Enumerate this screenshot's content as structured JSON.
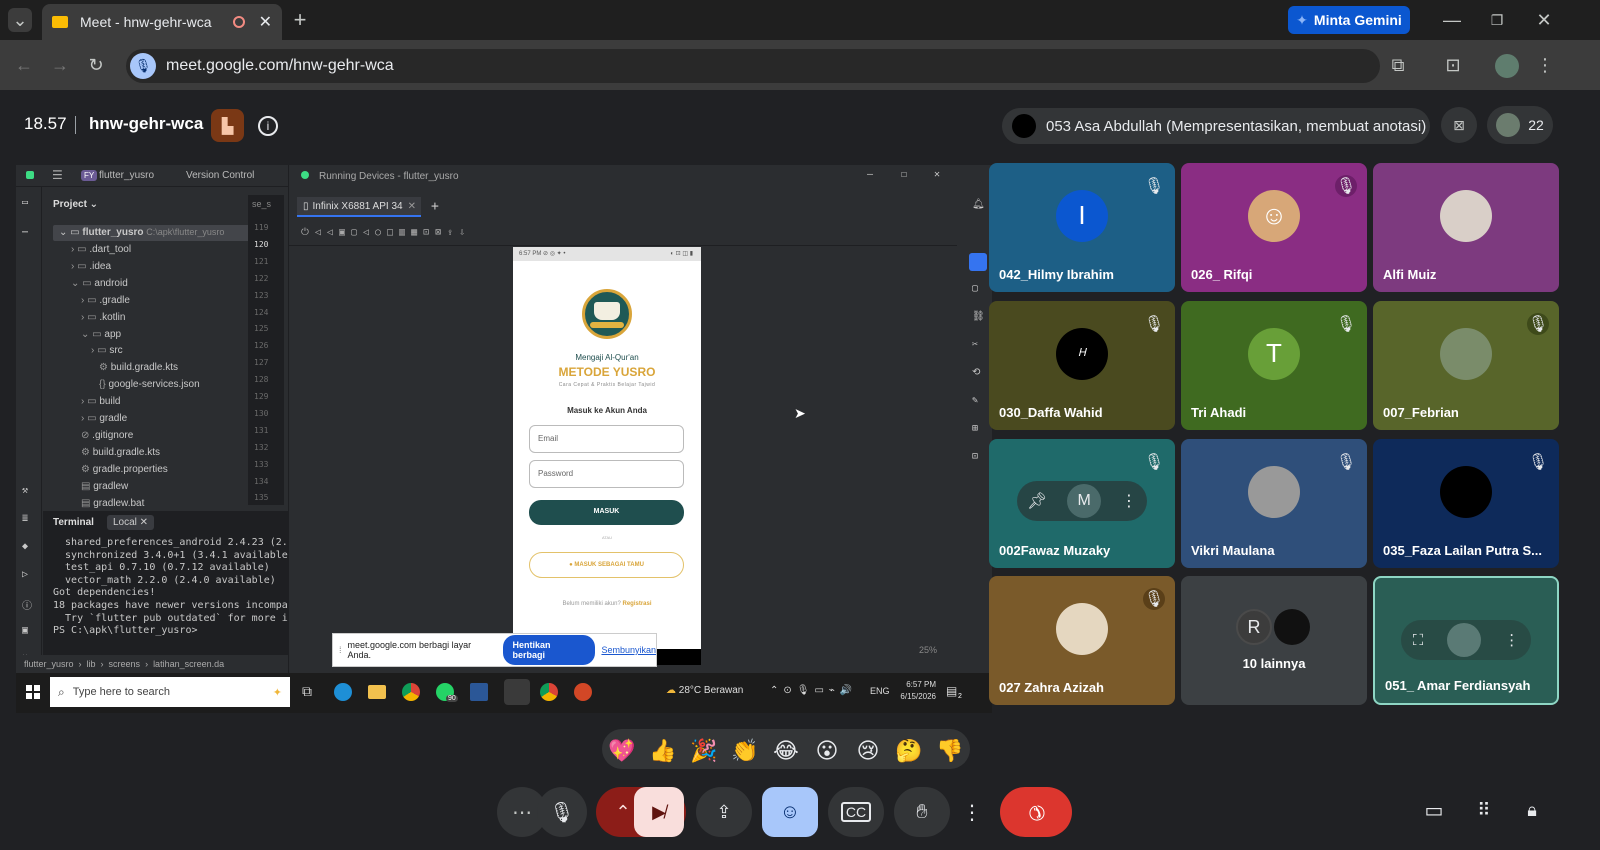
{
  "browser": {
    "tab_title": "Meet - hnw-gehr-wca",
    "gemini_label": "Minta Gemini",
    "url": "meet.google.com/hnw-gehr-wca"
  },
  "meeting": {
    "time": "18.57",
    "code": "hnw-gehr-wca",
    "presenter": "053 Asa Abdullah (Mempresentasikan, membuat anotasi)",
    "participant_count": "22"
  },
  "ide": {
    "project_badge": "FY",
    "project_name": "flutter_yusro",
    "version_control": "Version Control",
    "running_title": "Running Devices - flutter_yusro",
    "device_tab": "Infinix X6881 API 34",
    "project_label": "Project",
    "tree_root": "flutter_yusro",
    "tree_root_path": "C:\\apk\\flutter_yusro",
    "tree": [
      ".dart_tool",
      ".idea",
      "android",
      ".gradle",
      ".kotlin",
      "app",
      "src",
      "build.gradle.kts",
      "google-services.json",
      "build",
      "gradle",
      ".gitignore",
      "build.gradle.kts",
      "gradle.properties",
      "gradlew",
      "gradlew.bat"
    ],
    "line_numbers": [
      "119",
      "120",
      "121",
      "122",
      "123",
      "124",
      "125",
      "126",
      "127",
      "128",
      "129",
      "130",
      "131",
      "132",
      "133",
      "134",
      "135"
    ],
    "terminal_tab": "Terminal",
    "terminal_local": "Local",
    "terminal_lines": [
      "  shared_preferences_android 2.4.23 (2.4",
      "  synchronized 3.4.0+1 (3.4.1 available)",
      "  test_api 0.7.10 (0.7.12 available)",
      "  vector_math 2.2.0 (2.4.0 available)",
      "Got dependencies!",
      "18 packages have newer versions incompat",
      "  Try `flutter pub outdated` for more info",
      "",
      "PS C:\\apk\\flutter_yusro> "
    ],
    "breadcrumb": [
      "flutter_yusro",
      "lib",
      "screens",
      "latihan_screen.da"
    ],
    "zoom": "25%"
  },
  "phone": {
    "status_time": "6:57 PM",
    "tagline": "Mengaji Al-Qur'an",
    "app_title": "METODE YUSRO",
    "subtitle": "Cara Cepat & Praktis Belajar Tajwid",
    "login_heading": "Masuk ke Akun Anda",
    "email_placeholder": "Email",
    "password_placeholder": "Password",
    "login_button": "MASUK",
    "divider": "ATAU",
    "guest_button": "MASUK SEBAGAI TAMU",
    "no_account": "Belum memiliki akun?",
    "register": "Registrasi"
  },
  "share_banner": {
    "text": "meet.google.com berbagi layar Anda.",
    "stop": "Hentikan berbagi",
    "hide": "Sembunyikan"
  },
  "taskbar": {
    "search_placeholder": "Type here to search",
    "whatsapp_badge": "90",
    "weather": "28°C  Berawan",
    "lang": "ENG",
    "time": "6:57 PM",
    "date": "6/15/2026",
    "notif": "2"
  },
  "participants": [
    {
      "name": "042_Hilmy Ibrahim",
      "initial": "I"
    },
    {
      "name": "026_ Rifqi"
    },
    {
      "name": "Alfi Muiz"
    },
    {
      "name": "030_Daffa Wahid"
    },
    {
      "name": "Tri Ahadi",
      "initial": "T"
    },
    {
      "name": "007_Febrian"
    },
    {
      "name": "002Fawaz Muzaky",
      "initial": "M"
    },
    {
      "name": "Vikri Maulana"
    },
    {
      "name": "035_Faza Lailan Putra S..."
    },
    {
      "name": "027 Zahra Azizah"
    },
    {
      "name": "10 lainnya",
      "initial": "R"
    },
    {
      "name": "051_ Amar Ferdiansyah"
    }
  ],
  "reactions": [
    "💖",
    "👍",
    "🎉",
    "👏",
    "😂",
    "😮",
    "😢",
    "🤔",
    "👎"
  ],
  "colors": {
    "leave": "#dc362e",
    "camera_off": "#f9dedc",
    "active": "#a8c7fa",
    "accent_teal": "#1f4e4e"
  }
}
